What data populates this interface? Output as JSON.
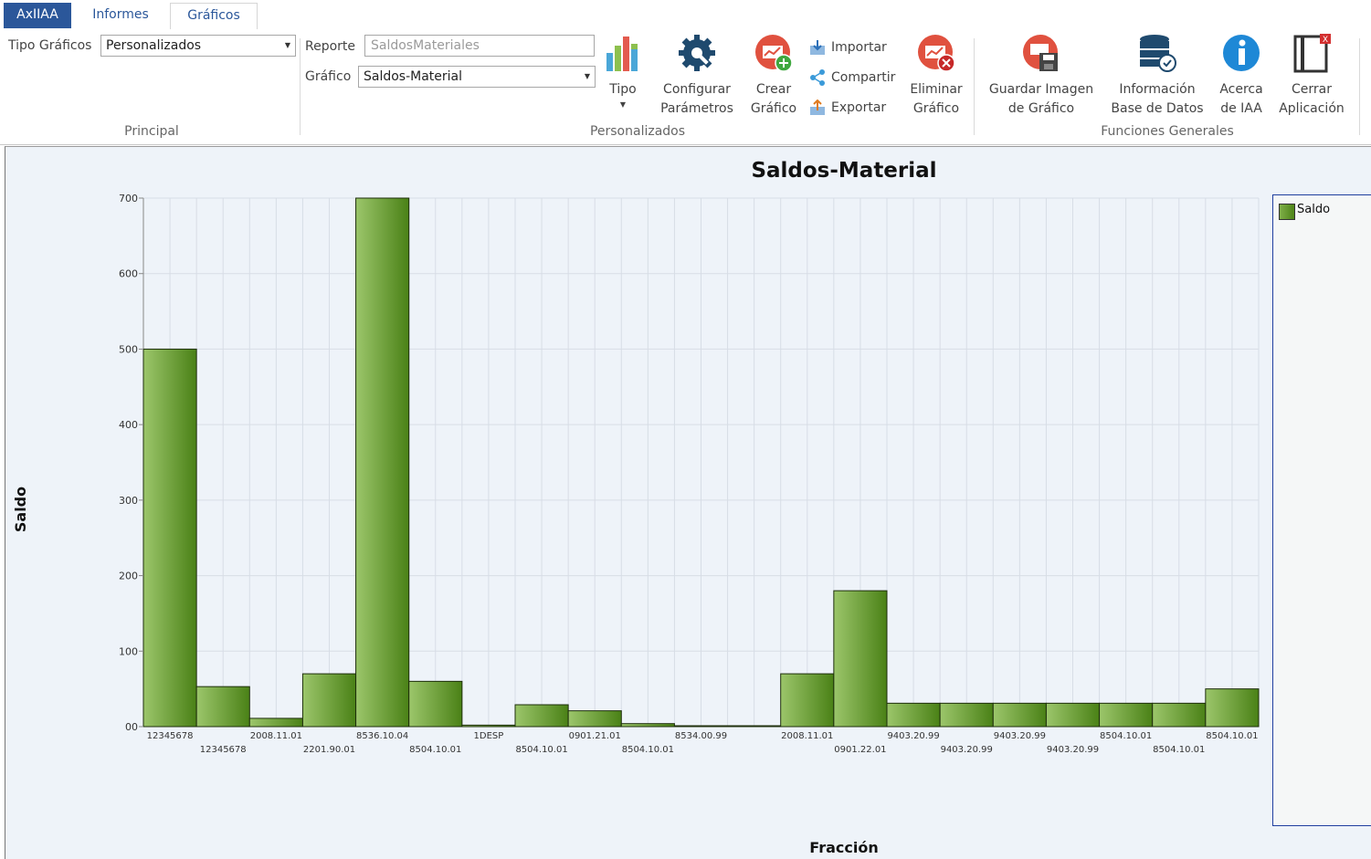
{
  "tabs": {
    "app": "AxIIAA",
    "informes": "Informes",
    "graficos": "Gráficos"
  },
  "principal": {
    "tipo_label": "Tipo Gráficos",
    "tipo_value": "Personalizados",
    "group_label": "Principal"
  },
  "personalizados": {
    "reporte_label": "Reporte",
    "reporte_value": "SaldosMateriales",
    "grafico_label": "Gráfico",
    "grafico_value": "Saldos-Material",
    "tipo": "Tipo",
    "configurar_1": "Configurar",
    "configurar_2": "Parámetros",
    "crear_1": "Crear",
    "crear_2": "Gráfico",
    "importar": "Importar",
    "compartir": "Compartir",
    "exportar": "Exportar",
    "eliminar_1": "Eliminar",
    "eliminar_2": "Gráfico",
    "group_label": "Personalizados"
  },
  "funciones": {
    "guardar_1": "Guardar Imagen",
    "guardar_2": "de Gráfico",
    "info_1": "Información",
    "info_2": "Base de Datos",
    "acerca_1": "Acerca",
    "acerca_2": "de IAA",
    "cerrar_1": "Cerrar",
    "cerrar_2": "Aplicación",
    "group_label": "Funciones Generales"
  },
  "colors": {
    "accent": "#2b579a",
    "bar_light": "#97c066",
    "bar_dark": "#4a8116",
    "chart_bg": "#eef3f9"
  },
  "chart_data": {
    "type": "bar",
    "title": "Saldos-Material",
    "xlabel": "Fracción",
    "ylabel": "Saldo",
    "ylim": [
      0,
      700
    ],
    "yticks": [
      "00",
      "100",
      "200",
      "300",
      "400",
      "500",
      "600",
      "700"
    ],
    "grid": true,
    "legend_position": "right",
    "categories": [
      "12345678",
      "12345678",
      "2008.11.01",
      "2201.90.01",
      "8536.10.04",
      "8504.10.01",
      "1DESP",
      "8504.10.01",
      "0901.21.01",
      "8504.10.01",
      "8534.00.99",
      "",
      "2008.11.01",
      "0901.22.01",
      "9403.20.99",
      "9403.20.99",
      "9403.20.99",
      "9403.20.99",
      "8504.10.01",
      "8504.10.01",
      "8504.10.01"
    ],
    "series": [
      {
        "name": "Saldo",
        "values": [
          500,
          53,
          11,
          70,
          700,
          60,
          2,
          29,
          21,
          4,
          1,
          1,
          70,
          180,
          31,
          31,
          31,
          31,
          31,
          31,
          50
        ]
      }
    ]
  }
}
